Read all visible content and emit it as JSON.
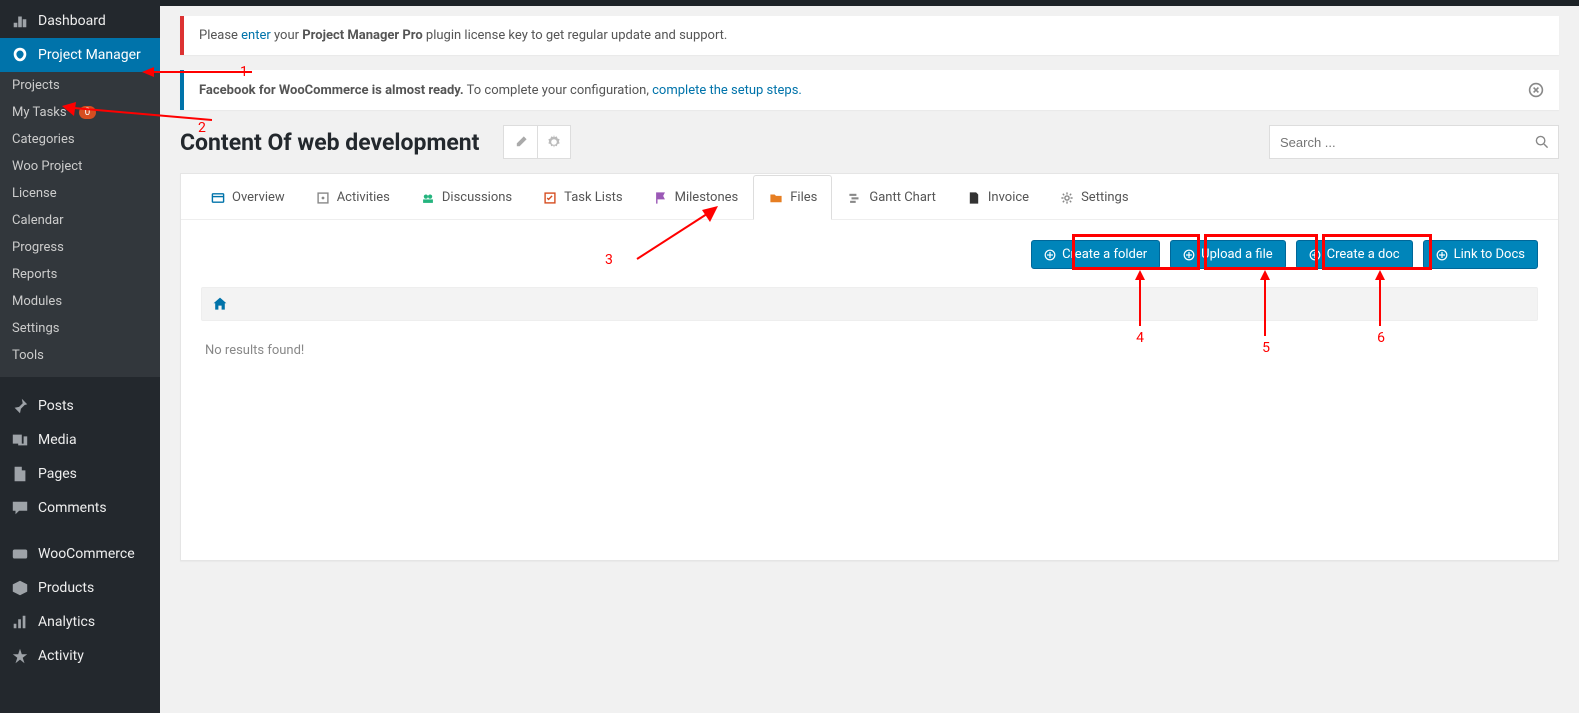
{
  "sidebar": {
    "primary": [
      {
        "label": "Dashboard",
        "icon": "dash"
      },
      {
        "label": "Project Manager",
        "icon": "pm",
        "active": true
      }
    ],
    "submenus": [
      {
        "label": "Projects"
      },
      {
        "label": "My Tasks",
        "badge": "0"
      },
      {
        "label": "Categories"
      },
      {
        "label": "Woo Project"
      },
      {
        "label": "License"
      },
      {
        "label": "Calendar"
      },
      {
        "label": "Progress"
      },
      {
        "label": "Reports"
      },
      {
        "label": "Modules"
      },
      {
        "label": "Settings"
      },
      {
        "label": "Tools"
      }
    ],
    "secondary": [
      {
        "label": "Posts",
        "icon": "pin"
      },
      {
        "label": "Media",
        "icon": "media"
      },
      {
        "label": "Pages",
        "icon": "pages"
      },
      {
        "label": "Comments",
        "icon": "comment"
      },
      {
        "label": "WooCommerce",
        "icon": "woo",
        "sep_before": true
      },
      {
        "label": "Products",
        "icon": "prod"
      },
      {
        "label": "Analytics",
        "icon": "chart"
      },
      {
        "label": "Activity",
        "icon": "activity"
      }
    ]
  },
  "notices": {
    "license": {
      "prefix": "Please ",
      "link": "enter",
      "middle": " your ",
      "bold": "Project Manager Pro",
      "suffix": " plugin license key to get regular update and support."
    },
    "fb": {
      "bold": "Facebook for WooCommerce is almost ready.",
      "text": " To complete your configuration, ",
      "link": "complete the setup steps."
    }
  },
  "page_title": "Content Of web development",
  "search_placeholder": "Search ...",
  "tabs": [
    {
      "label": "Overview",
      "icon": "overview",
      "color": "#0073aa"
    },
    {
      "label": "Activities",
      "icon": "activities",
      "color": "#888"
    },
    {
      "label": "Discussions",
      "icon": "discussions",
      "color": "#24b47e"
    },
    {
      "label": "Task Lists",
      "icon": "tasklists",
      "color": "#d54e21"
    },
    {
      "label": "Milestones",
      "icon": "milestones",
      "color": "#9b59b6"
    },
    {
      "label": "Files",
      "icon": "files",
      "color": "#e67e22",
      "active": true
    },
    {
      "label": "Gantt Chart",
      "icon": "gantt",
      "color": "#888"
    },
    {
      "label": "Invoice",
      "icon": "invoice",
      "color": "#333"
    },
    {
      "label": "Settings",
      "icon": "settings",
      "color": "#888"
    }
  ],
  "actions": [
    {
      "label": "Create a folder"
    },
    {
      "label": "Upload a file"
    },
    {
      "label": "Create a doc"
    },
    {
      "label": "Link to Docs"
    }
  ],
  "empty_text": "No results found!",
  "annotations": {
    "n1": "1",
    "n2": "2",
    "n3": "3",
    "n4": "4",
    "n5": "5",
    "n6": "6"
  }
}
